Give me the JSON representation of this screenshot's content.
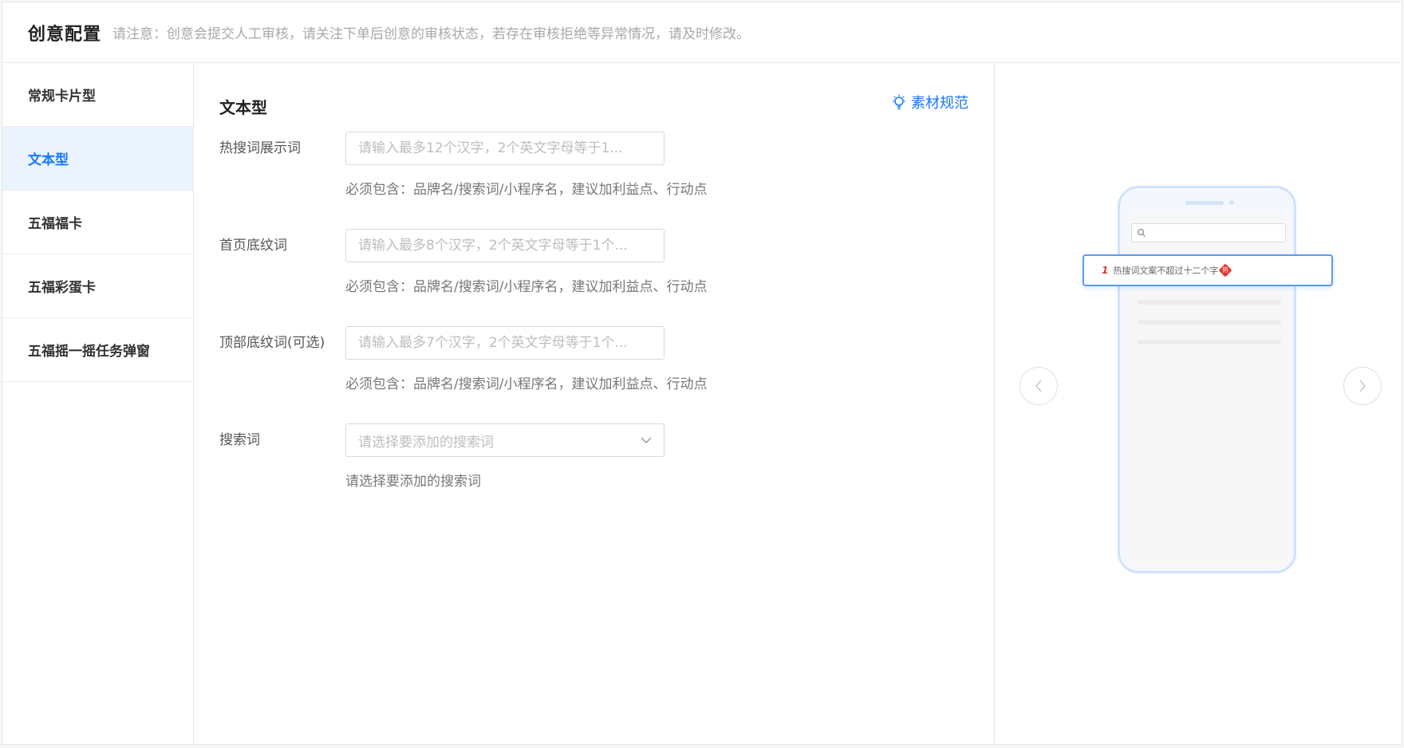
{
  "header": {
    "title": "创意配置",
    "notice": "请注意：创意会提交人工审核，请关注下单后创意的审核状态，若存在审核拒绝等异常情况，请及时修改。"
  },
  "sidebar": {
    "items": [
      {
        "label": "常规卡片型",
        "active": false
      },
      {
        "label": "文本型",
        "active": true
      },
      {
        "label": "五福福卡",
        "active": false
      },
      {
        "label": "五福彩蛋卡",
        "active": false
      },
      {
        "label": "五福摇一摇任务弹窗",
        "active": false
      }
    ]
  },
  "form": {
    "section_title": "文本型",
    "guide_link": "素材规范",
    "guide_icon": "lightbulb-icon",
    "fields": [
      {
        "label": "热搜词展示词",
        "placeholder": "请输入最多12个汉字，2个英文字母等于1...",
        "hint": "必须包含：品牌名/搜索词/小程序名，建议加利益点、行动点"
      },
      {
        "label": "首页底纹词",
        "placeholder": "请输入最多8个汉字，2个英文字母等于1个...",
        "hint": "必须包含：品牌名/搜索词/小程序名，建议加利益点、行动点"
      },
      {
        "label": "顶部底纹词(可选)",
        "placeholder": "请输入最多7个汉字，2个英文字母等于1个...",
        "hint": "必须包含：品牌名/搜索词/小程序名，建议加利益点、行动点"
      }
    ],
    "search_select": {
      "label": "搜索词",
      "placeholder": "请选择要添加的搜索词",
      "hint": "请选择要添加的搜索词",
      "icon": "chevron-down-icon"
    }
  },
  "preview": {
    "hot_rank": "1",
    "hot_text": "热搜词文案不超过十二个字",
    "hot_badge": "热",
    "prev_icon": "chevron-left-icon",
    "next_icon": "chevron-right-icon"
  },
  "colors": {
    "accent": "#1677ff",
    "active_bg": "#eaf3fe",
    "hot_red": "#e3342f"
  }
}
